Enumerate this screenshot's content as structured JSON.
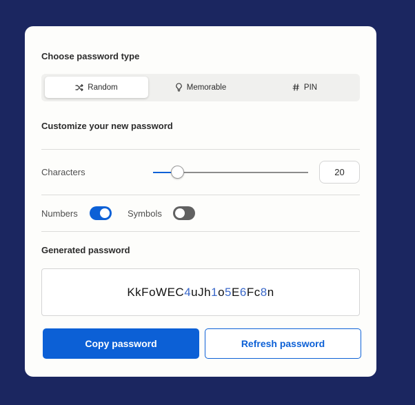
{
  "type_section": {
    "title": "Choose password type",
    "options": [
      {
        "label": "Random",
        "icon": "shuffle-icon",
        "selected": true
      },
      {
        "label": "Memorable",
        "icon": "lightbulb-icon",
        "selected": false
      },
      {
        "label": "PIN",
        "icon": "hash-icon",
        "selected": false
      }
    ]
  },
  "customize": {
    "title": "Customize your new password",
    "characters_label": "Characters",
    "characters_value": "20",
    "numbers_label": "Numbers",
    "numbers_on": true,
    "symbols_label": "Symbols",
    "symbols_on": false
  },
  "generated": {
    "title": "Generated password",
    "password": "KkFoWEC4uJh1o5E6Fc8n"
  },
  "buttons": {
    "copy": "Copy password",
    "refresh": "Refresh password"
  },
  "colors": {
    "background": "#1b2660",
    "accent": "#0c60d6",
    "digit": "#3967c9",
    "toggle_off": "#616161"
  }
}
